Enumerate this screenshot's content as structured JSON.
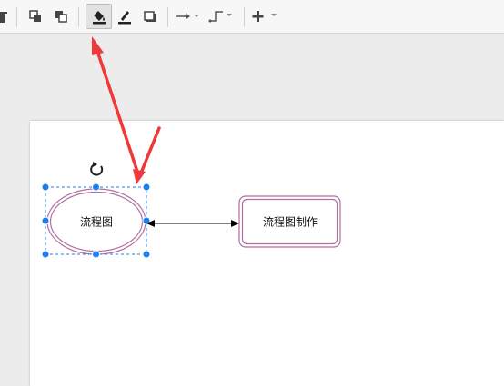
{
  "toolbar": {
    "buttons": [
      {
        "name": "menu-partial-icon",
        "label": ""
      },
      {
        "name": "to-front-icon",
        "label": ""
      },
      {
        "name": "to-back-icon",
        "label": ""
      },
      {
        "name": "fill-color-icon",
        "label": "",
        "active": true
      },
      {
        "name": "line-color-icon",
        "label": ""
      },
      {
        "name": "shadow-icon",
        "label": ""
      },
      {
        "name": "connection-icon",
        "label": ""
      },
      {
        "name": "waypoints-icon",
        "label": ""
      },
      {
        "name": "insert-icon",
        "label": ""
      }
    ]
  },
  "diagram": {
    "shapes": [
      {
        "id": "ellipse",
        "type": "ellipse",
        "text": "流程图",
        "selected": true
      },
      {
        "id": "rect",
        "type": "rounded-rectangle",
        "text": "流程图制作",
        "selected": false
      }
    ],
    "connector": {
      "from": "ellipse",
      "to": "rect",
      "style": "bidirectional-arrow"
    }
  },
  "annotations": {
    "arrow_color": "#f0373a",
    "description": ""
  },
  "colors": {
    "shape_border": "#b070a0",
    "selection_handle": "#1a7ff0",
    "connector": "#000000"
  }
}
